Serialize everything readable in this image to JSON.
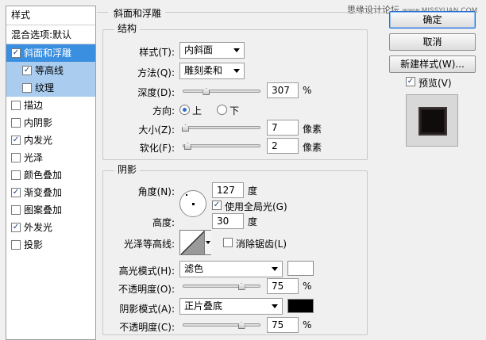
{
  "watermark": {
    "text": "思缘设计论坛",
    "url": "www.MISSYUAN.COM"
  },
  "left_panel": {
    "header": "样式",
    "blend_options": "混合选项:默认",
    "items": [
      {
        "label": "斜面和浮雕",
        "checked": true,
        "state": "selected"
      },
      {
        "label": "等高线",
        "checked": true,
        "state": "sub"
      },
      {
        "label": "纹理",
        "checked": false,
        "state": "sub"
      },
      {
        "label": "描边",
        "checked": false
      },
      {
        "label": "内阴影",
        "checked": false
      },
      {
        "label": "内发光",
        "checked": true
      },
      {
        "label": "光泽",
        "checked": false
      },
      {
        "label": "颜色叠加",
        "checked": false
      },
      {
        "label": "渐变叠加",
        "checked": true
      },
      {
        "label": "图案叠加",
        "checked": false
      },
      {
        "label": "外发光",
        "checked": true
      },
      {
        "label": "投影",
        "checked": false
      }
    ]
  },
  "bevel": {
    "section_title": "斜面和浮雕",
    "structure_title": "结构",
    "style_label": "样式(T):",
    "style_value": "内斜面",
    "technique_label": "方法(Q):",
    "technique_value": "雕刻柔和",
    "depth_label": "深度(D):",
    "depth_value": "307",
    "depth_unit": "%",
    "depth_slider": 0.3,
    "direction_label": "方向:",
    "direction_up": "上",
    "direction_down": "下",
    "size_label": "大小(Z):",
    "size_value": "7",
    "size_unit": "像素",
    "size_slider": 0.03,
    "soften_label": "软化(F):",
    "soften_value": "2",
    "soften_unit": "像素",
    "soften_slider": 0.06
  },
  "shading": {
    "title": "阴影",
    "angle_label": "角度(N):",
    "angle_value": "127",
    "angle_unit": "度",
    "global_light_label": "使用全局光(G)",
    "altitude_label": "高度:",
    "altitude_value": "30",
    "altitude_unit": "度",
    "gloss_contour_label": "光泽等高线:",
    "anti_alias_label": "消除锯齿(L)",
    "highlight_mode_label": "高光模式(H):",
    "highlight_mode_value": "滤色",
    "highlight_color": "#ffffff",
    "highlight_opacity_label": "不透明度(O):",
    "highlight_opacity_value": "75",
    "highlight_opacity_unit": "%",
    "highlight_opacity_slider": 0.75,
    "shadow_mode_label": "阴影模式(A):",
    "shadow_mode_value": "正片叠底",
    "shadow_color": "#000000",
    "shadow_opacity_label": "不透明度(C):",
    "shadow_opacity_value": "75",
    "shadow_opacity_unit": "%",
    "shadow_opacity_slider": 0.75
  },
  "buttons": {
    "ok": "确定",
    "cancel": "取消",
    "new_style": "新建样式(W)...",
    "preview_label": "预览(V)"
  }
}
